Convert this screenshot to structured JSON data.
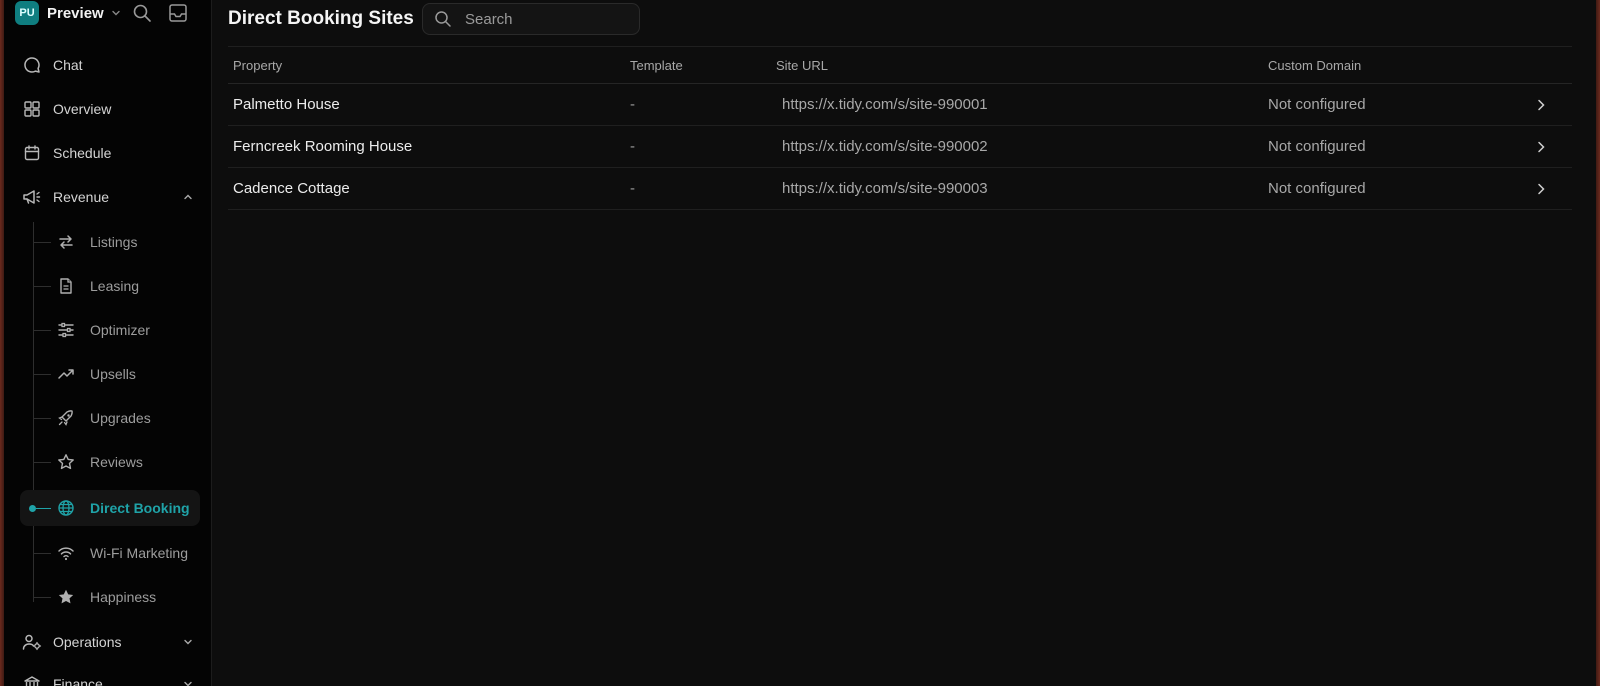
{
  "workspace": {
    "initials": "PU",
    "name": "Preview"
  },
  "sidebar": {
    "items": [
      {
        "label": "Chat",
        "icon": "chat-bubble-icon"
      },
      {
        "label": "Overview",
        "icon": "grid-icon"
      },
      {
        "label": "Schedule",
        "icon": "calendar-icon"
      },
      {
        "label": "Revenue",
        "icon": "megaphone-icon",
        "expanded": true
      },
      {
        "label": "Operations",
        "icon": "people-gear-icon",
        "expanded": false
      },
      {
        "label": "Finance",
        "icon": "bank-icon",
        "expanded": false
      }
    ],
    "revenue_children": [
      {
        "label": "Listings",
        "icon": "swap-arrows-icon"
      },
      {
        "label": "Leasing",
        "icon": "document-icon"
      },
      {
        "label": "Optimizer",
        "icon": "sliders-icon"
      },
      {
        "label": "Upsells",
        "icon": "trending-up-icon"
      },
      {
        "label": "Upgrades",
        "icon": "rocket-icon"
      },
      {
        "label": "Reviews",
        "icon": "star-outline-icon"
      },
      {
        "label": "Direct Booking",
        "icon": "globe-icon",
        "active": true
      },
      {
        "label": "Wi-Fi Marketing",
        "icon": "wifi-icon"
      },
      {
        "label": "Happiness",
        "icon": "star-filled-icon"
      }
    ]
  },
  "main": {
    "title": "Direct Booking Sites",
    "search": {
      "placeholder": "Search",
      "value": ""
    },
    "table": {
      "headers": [
        "Property",
        "Template",
        "Site URL",
        "Custom Domain"
      ],
      "rows": [
        {
          "property": "Palmetto House",
          "template": "-",
          "url": "https://x.tidy.com/s/site-990001",
          "domain": "Not configured"
        },
        {
          "property": "Ferncreek Rooming House",
          "template": "-",
          "url": "https://x.tidy.com/s/site-990002",
          "domain": "Not configured"
        },
        {
          "property": "Cadence Cottage",
          "template": "-",
          "url": "https://x.tidy.com/s/site-990003",
          "domain": "Not configured"
        }
      ]
    }
  },
  "colors": {
    "accent": "#1fa3a8",
    "background": "#0d0d0d",
    "sidebar": "#040404"
  }
}
